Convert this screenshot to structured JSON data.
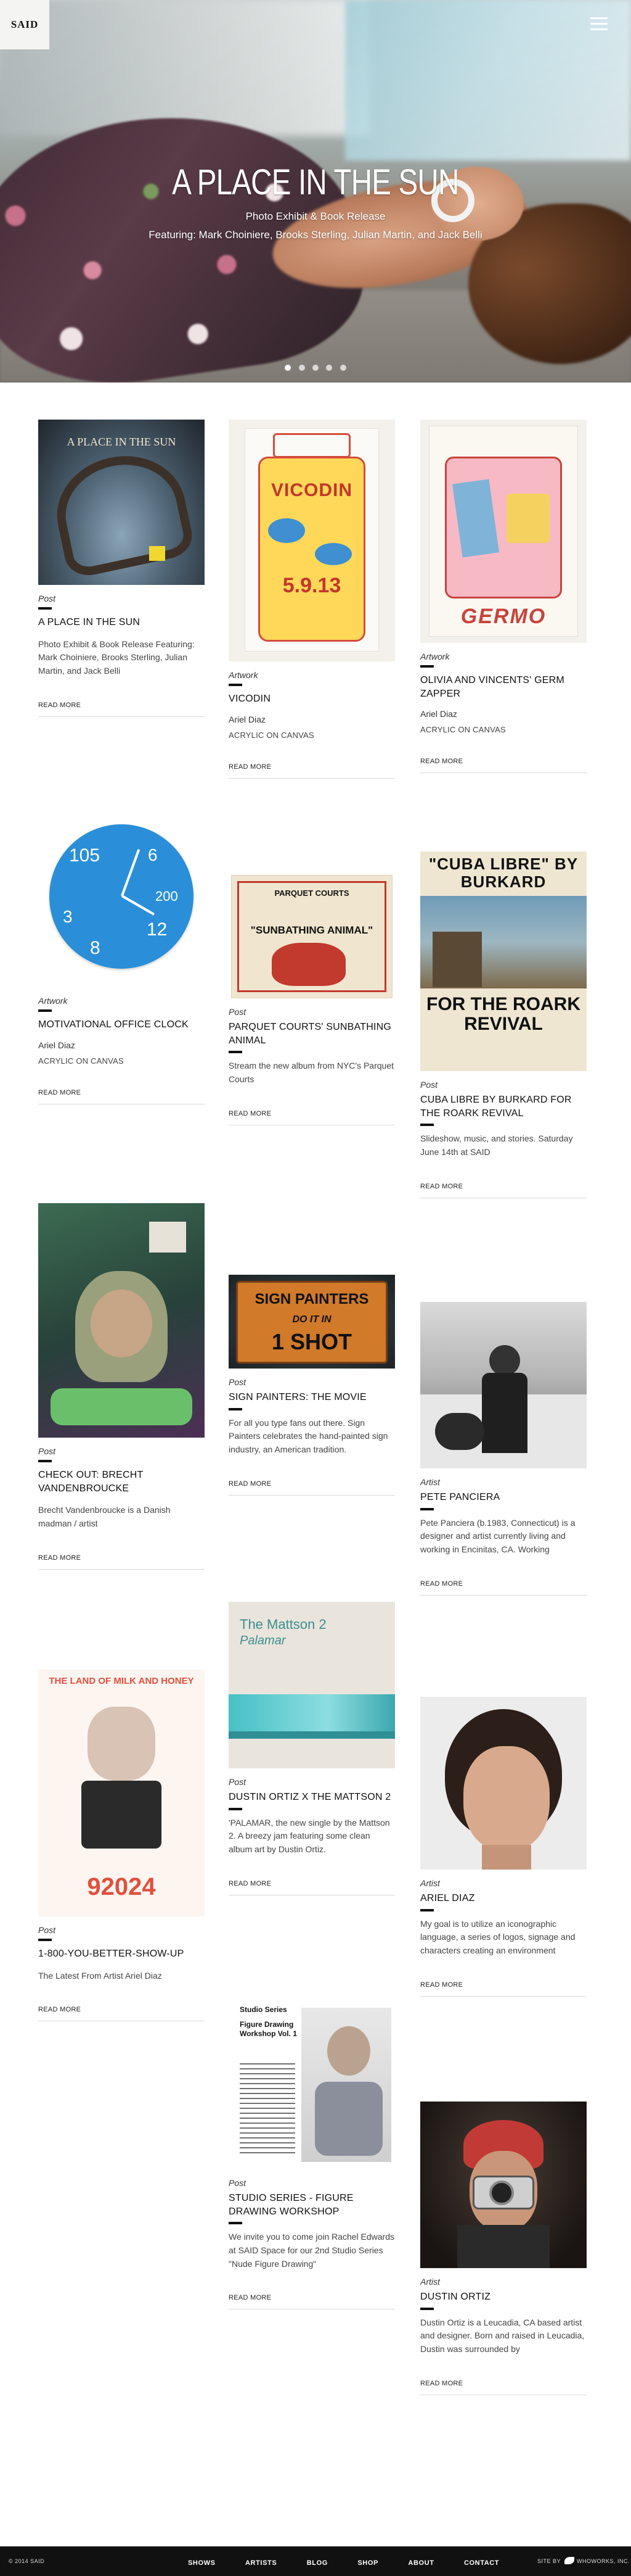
{
  "brand": {
    "logo_text": "SAID"
  },
  "hero": {
    "title": "A PLACE IN THE SUN",
    "subtitle": "Photo Exhibit & Book Release",
    "featuring": "Featuring: Mark Choiniere, Brooks Sterling, Julian Martin, and Jack Belli",
    "slide_count": 5,
    "active_slide": 1
  },
  "read_more_label": "READ MORE",
  "posts": [
    {
      "category": "Post",
      "title": "A PLACE IN THE SUN",
      "description": "Photo Exhibit & Book Release Featuring: Mark Choiniere, Brooks Sterling, Julian Martin, and Jack Belli",
      "thumb_title": "A PLACE IN THE SUN"
    },
    {
      "category": "Artwork",
      "title": "VICODIN",
      "artist": "Ariel Diaz",
      "medium": "ACRYLIC ON CANVAS",
      "thumb_text": "VICODIN",
      "thumb_date": "5.9.13"
    },
    {
      "category": "Artwork",
      "title": "OLIVIA AND VINCENTS' GERM ZAPPER",
      "artist": "Ariel Diaz",
      "medium": "ACRYLIC ON CANVAS",
      "thumb_text": "GERMO"
    },
    {
      "category": "Artwork",
      "title": "MOTIVATIONAL OFFICE CLOCK",
      "artist": "Ariel Diaz",
      "medium": "ACRYLIC ON CANVAS"
    },
    {
      "category": "Post",
      "title": "PARQUET COURTS' SUNBATHING ANIMAL",
      "description": "Stream the new album from NYC's Parquet Courts",
      "thumb_line1": "PARQUET COURTS",
      "thumb_line2": "\"SUNBATHING ANIMAL\""
    },
    {
      "category": "Post",
      "title": "CUBA LIBRE BY BURKARD FOR THE ROARK REVIVAL",
      "description": "Slideshow, music, and stories. Saturday June 14th at SAID",
      "thumb_top": "\"CUBA LIBRE\" BY BURKARD",
      "thumb_bottom": "FOR THE ROARK REVIVAL"
    },
    {
      "category": "Post",
      "title": "CHECK OUT: BRECHT VANDENBROUCKE",
      "description": "Brecht Vandenbroucke is a Danish madman / artist"
    },
    {
      "category": "Post",
      "title": "SIGN PAINTERS: THE MOVIE",
      "description": "For all you type fans out there. Sign Painters celebrates the hand-painted sign industry, an American tradition.",
      "thumb_line1": "SIGN PAINTERS",
      "thumb_line2": "DO IT IN",
      "thumb_line3": "1 SHOT"
    },
    {
      "category": "Artist",
      "title": "PETE PANCIERA",
      "description": "Pete Panciera (b.1983, Connecticut) is a designer and artist currently living and working in Encinitas, CA. Working"
    },
    {
      "category": "Post",
      "title": "DUSTIN ORTIZ X THE MATTSON 2",
      "description": "'PALAMAR, the new single by the Mattson 2. A breezy jam featuring some clean album art by Dustin Ortiz.",
      "thumb_line1": "The Mattson 2",
      "thumb_line2": "Palamar"
    },
    {
      "category": "Post",
      "title": "1-800-YOU-BETTER-SHOW-UP",
      "description": "The Latest From Artist Ariel Diaz",
      "thumb_top": "THE LAND OF MILK AND HONEY",
      "thumb_bottom": "92024"
    },
    {
      "category": "Artist",
      "title": "ARIEL DIAZ",
      "description": "My goal is to utilize an iconographic language, a series of logos, signage and characters creating an environment"
    },
    {
      "category": "Post",
      "title": "STUDIO SERIES - FIGURE DRAWING WORKSHOP",
      "description": "We invite you to come join Rachel Edwards at SAID Space for our 2nd Studio Series \"Nude Figure Drawing\"",
      "thumb_line1": "Studio Series",
      "thumb_line2": "Figure Drawing Workshop Vol. 1"
    },
    {
      "category": "Artist",
      "title": "DUSTIN ORTIZ",
      "description": "Dustin Ortiz is a Leucadia, CA based artist and designer. Born and raised in Leucadia, Dustin was surrounded by"
    }
  ],
  "footer": {
    "copyright": "© 2014 SAID",
    "nav": [
      "SHOWS",
      "ARTISTS",
      "BLOG",
      "SHOP",
      "ABOUT",
      "CONTACT"
    ],
    "site_by": "SITE BY",
    "credit": "WHOWORKS, INC."
  }
}
